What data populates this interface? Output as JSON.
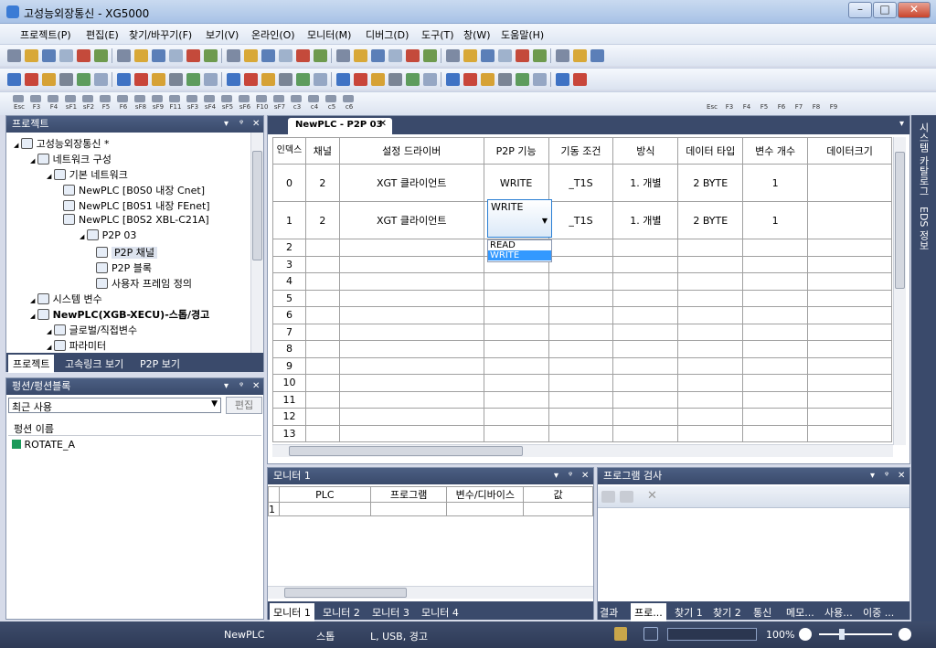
{
  "window": {
    "title": "고성능외장통신 - XG5000"
  },
  "menu": [
    "프로젝트(P)",
    "편집(E)",
    "찾기/바꾸기(F)",
    "보기(V)",
    "온라인(O)",
    "모니터(M)",
    "디버그(D)",
    "도구(T)",
    "창(W)",
    "도움말(H)"
  ],
  "toolbar3_labels": [
    "Esc",
    "F3",
    "F4",
    "sF1",
    "sF2",
    "F5",
    "F6",
    "sF8",
    "sF9",
    "F11",
    "sF3",
    "sF4",
    "sF5",
    "sF6",
    "F10",
    "sF7",
    "c3",
    "c4",
    "c5",
    "c6"
  ],
  "toolbar_right_labels": [
    "Esc",
    "F3",
    "F4",
    "F5",
    "F6",
    "F7",
    "F8",
    "F9"
  ],
  "project_panel": {
    "title": "프로젝트",
    "tree": [
      {
        "label": "고성능외장통신 *",
        "level": 0
      },
      {
        "label": "네트워크 구성",
        "level": 1
      },
      {
        "label": "기본 네트워크",
        "level": 2
      },
      {
        "label": "NewPLC [B0S0 내장 Cnet]",
        "level": 3
      },
      {
        "label": "NewPLC [B0S1 내장 FEnet]",
        "level": 3
      },
      {
        "label": "NewPLC [B0S2 XBL-C21A]",
        "level": 3
      },
      {
        "label": "P2P 03",
        "level": 4
      },
      {
        "label": "P2P 채널",
        "level": 5
      },
      {
        "label": "P2P 블록",
        "level": 5
      },
      {
        "label": "사용자 프레임 정의",
        "level": 5
      },
      {
        "label": "시스템 변수",
        "level": 1
      },
      {
        "label": "NewPLC(XGB-XECU)-스톱/경고",
        "level": 1
      },
      {
        "label": "글로벌/직접변수",
        "level": 2
      },
      {
        "label": "파라미터",
        "level": 2
      }
    ],
    "tabs": [
      "프로젝트",
      "고속링크 보기",
      "P2P 보기"
    ]
  },
  "fb_panel": {
    "title": "펑션/펑션블록",
    "filter_value": "최근 사용",
    "edit_button": "편집",
    "list_header": "펑션 이름",
    "items": [
      "ROTATE_A"
    ]
  },
  "editor": {
    "tab_label": "NewPLC - P2P 03",
    "columns": [
      "인덱스",
      "채널",
      "설정 드라이버",
      "P2P 기능",
      "기동 조건",
      "방식",
      "데이터 타입",
      "변수 개수",
      "데이터크기"
    ],
    "rows": [
      {
        "idx": "0",
        "ch": "2",
        "drv": "XGT 클라이언트",
        "func": "WRITE",
        "cond": "_T1S",
        "mode": "1. 개별",
        "type": "2 BYTE",
        "cnt": "1",
        "size": ""
      },
      {
        "idx": "1",
        "ch": "2",
        "drv": "XGT 클라이언트",
        "func": "WRITE",
        "cond": "_T1S",
        "mode": "1. 개별",
        "type": "2 BYTE",
        "cnt": "1",
        "size": ""
      }
    ],
    "empty_rows": [
      "2",
      "3",
      "4",
      "5",
      "6",
      "7",
      "8",
      "9",
      "10",
      "11",
      "12",
      "13"
    ],
    "dropdown_options": [
      "READ",
      "WRITE"
    ],
    "dropdown_selected": "WRITE"
  },
  "right_sidebar": [
    "시스템 카탈로그",
    "EDS 정보"
  ],
  "monitor_panel": {
    "title": "모니터 1",
    "columns": [
      "PLC",
      "프로그램",
      "변수/디바이스",
      "값"
    ],
    "row_no": "1",
    "tabs": [
      "모니터 1",
      "모니터 2",
      "모니터 3",
      "모니터 4"
    ]
  },
  "check_panel": {
    "title": "프로그램 검사",
    "tabs": [
      "결과",
      "프로...",
      "찾기 1",
      "찾기 2",
      "통신",
      "메모...",
      "사용...",
      "이중 ..."
    ]
  },
  "status": {
    "plc": "NewPLC",
    "mode": "스톱",
    "conn": "L, USB, 경고",
    "zoom": "100%"
  },
  "colors": {
    "accent": "#3a4a6b",
    "selection": "#3399ff"
  }
}
